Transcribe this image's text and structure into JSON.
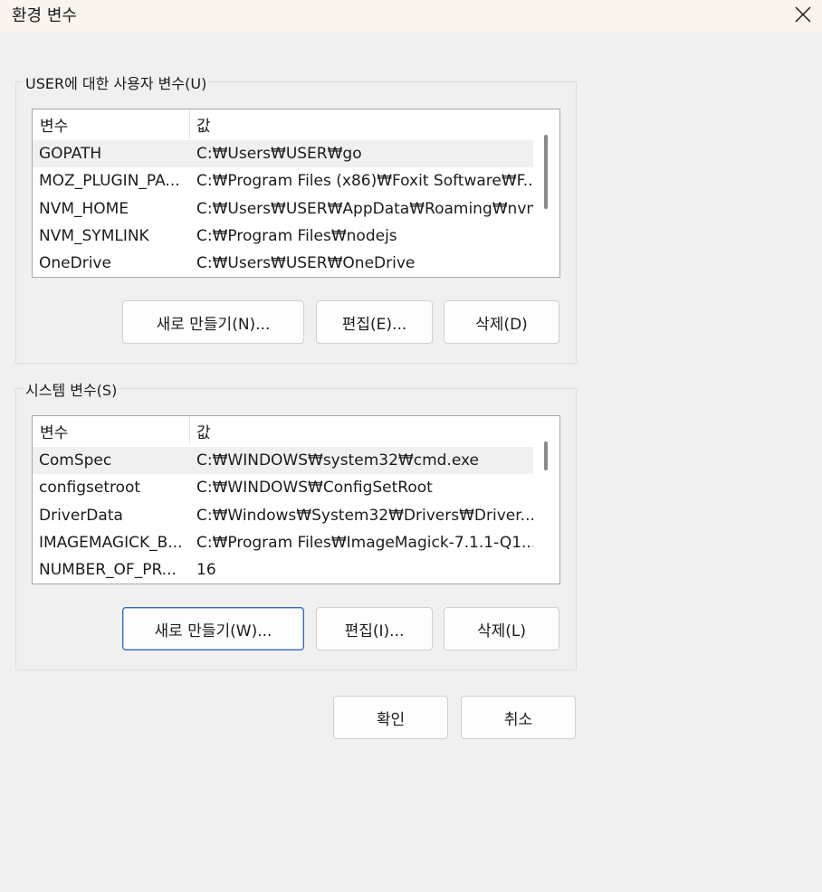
{
  "window": {
    "title": "환경 변수"
  },
  "user_group": {
    "title": "USER에 대한 사용자 변수(U)",
    "columns": {
      "name": "변수",
      "value": "값"
    },
    "rows": [
      {
        "name": "GOPATH",
        "value": "C:₩Users₩USER₩go"
      },
      {
        "name": "MOZ_PLUGIN_PA...",
        "value": "C:₩Program Files (x86)₩Foxit Software₩F..."
      },
      {
        "name": "NVM_HOME",
        "value": "C:₩Users₩USER₩AppData₩Roaming₩nvm"
      },
      {
        "name": "NVM_SYMLINK",
        "value": "C:₩Program Files₩nodejs"
      },
      {
        "name": "OneDrive",
        "value": "C:₩Users₩USER₩OneDrive"
      }
    ],
    "buttons": {
      "new": "새로 만들기(N)...",
      "edit": "편집(E)...",
      "delete": "삭제(D)"
    }
  },
  "system_group": {
    "title": "시스템 변수(S)",
    "columns": {
      "name": "변수",
      "value": "값"
    },
    "rows": [
      {
        "name": "ComSpec",
        "value": "C:₩WINDOWS₩system32₩cmd.exe"
      },
      {
        "name": "configsetroot",
        "value": "C:₩WINDOWS₩ConfigSetRoot"
      },
      {
        "name": "DriverData",
        "value": "C:₩Windows₩System32₩Drivers₩Driver..."
      },
      {
        "name": "IMAGEMAGICK_B...",
        "value": "C:₩Program Files₩ImageMagick-7.1.1-Q1..."
      },
      {
        "name": "NUMBER_OF_PR...",
        "value": "16"
      }
    ],
    "buttons": {
      "new": "새로 만들기(W)...",
      "edit": "편집(I)...",
      "delete": "삭제(L)"
    }
  },
  "footer": {
    "ok": "확인",
    "cancel": "취소"
  }
}
